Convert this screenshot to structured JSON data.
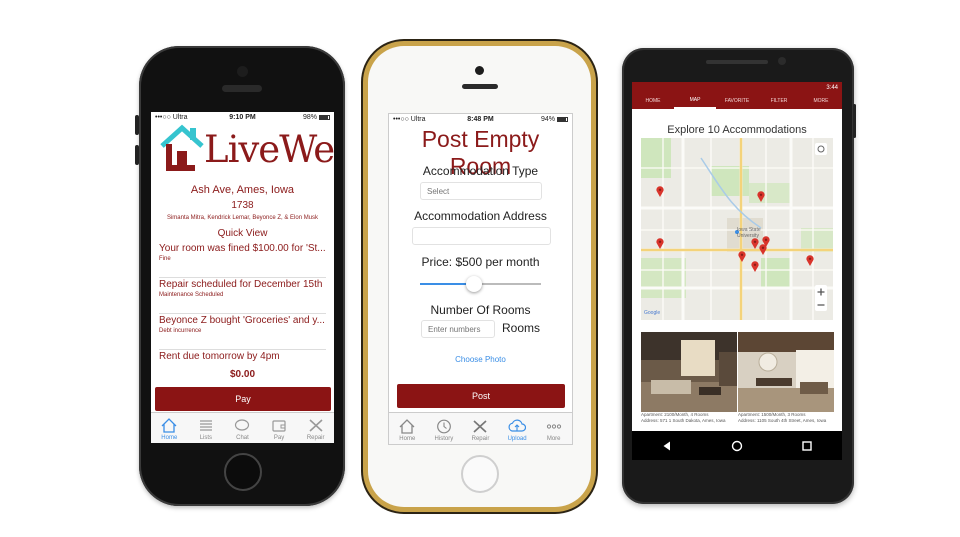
{
  "phone1": {
    "status": {
      "carrier": "•••○○ Ultra",
      "time": "9:10 PM",
      "battery": "98%"
    },
    "logo_text": "LiveWell",
    "address": "Ash Ave, Ames, Iowa",
    "number": "1738",
    "residents": "Simanta Mitra, Kendrick Lemar, Beyonce Z, & Elon Musk",
    "section_title": "Quick View",
    "feed": [
      {
        "title": "Your room was fined $100.00 for 'St...",
        "sub": "Fine"
      },
      {
        "title": "Repair scheduled for December 15th",
        "sub": "Maintenance Scheduled"
      },
      {
        "title": "Beyonce Z bought 'Groceries' and y...",
        "sub": "Debt incurrence"
      },
      {
        "title": "Rent due tomorrow by 4pm",
        "sub": ""
      }
    ],
    "amount": "$0.00",
    "pay_label": "Pay",
    "tabs": [
      {
        "label": "Home",
        "icon": "home-icon"
      },
      {
        "label": "Lists",
        "icon": "list-icon"
      },
      {
        "label": "Chat",
        "icon": "chat-icon"
      },
      {
        "label": "Pay",
        "icon": "wallet-icon"
      },
      {
        "label": "Repair",
        "icon": "tools-icon"
      }
    ]
  },
  "phone2": {
    "status": {
      "carrier": "•••○○ Ultra",
      "time": "8:48 PM",
      "battery": "94%"
    },
    "title": "Post Empty Room",
    "type_label": "Accommodation Type",
    "type_placeholder": "Select",
    "address_label": "Accommodation Address",
    "price_label": "Price: $500 per month",
    "price_slider_fraction": 0.45,
    "rooms_label": "Number Of Rooms",
    "rooms_placeholder": "Enter numbers",
    "rooms_suffix": "Rooms",
    "choose_photo": "Choose Photo",
    "post_label": "Post",
    "tabs": [
      {
        "label": "Home",
        "icon": "home-icon"
      },
      {
        "label": "History",
        "icon": "clock-icon"
      },
      {
        "label": "Repair",
        "icon": "tools-icon"
      },
      {
        "label": "Upload",
        "icon": "cloud-upload-icon"
      },
      {
        "label": "More",
        "icon": "more-icon"
      }
    ],
    "accent": "#3a8ee6"
  },
  "phone3": {
    "status_time": "3:44",
    "tabs": [
      "HOME",
      "MAP",
      "FAVORITE",
      "FILTER",
      "MORE"
    ],
    "heading": "Explore 10 Accommodations",
    "map_label": "Iowa State University",
    "map_watermark": "Google",
    "listings": [
      {
        "line1": "Apartment: 2100/Month, 4 Rooms",
        "line2": "Address: 571 1 South Dakota, Ames, Iowa"
      },
      {
        "line1": "Apartment: 1500/Month, 3 Rooms",
        "line2": "Address: 1105 South 4th Street, Ames, Iowa"
      }
    ]
  },
  "colors": {
    "brand": "#8b1414",
    "accent": "#3a8ee6",
    "logo_teal": "#36c4cf"
  }
}
